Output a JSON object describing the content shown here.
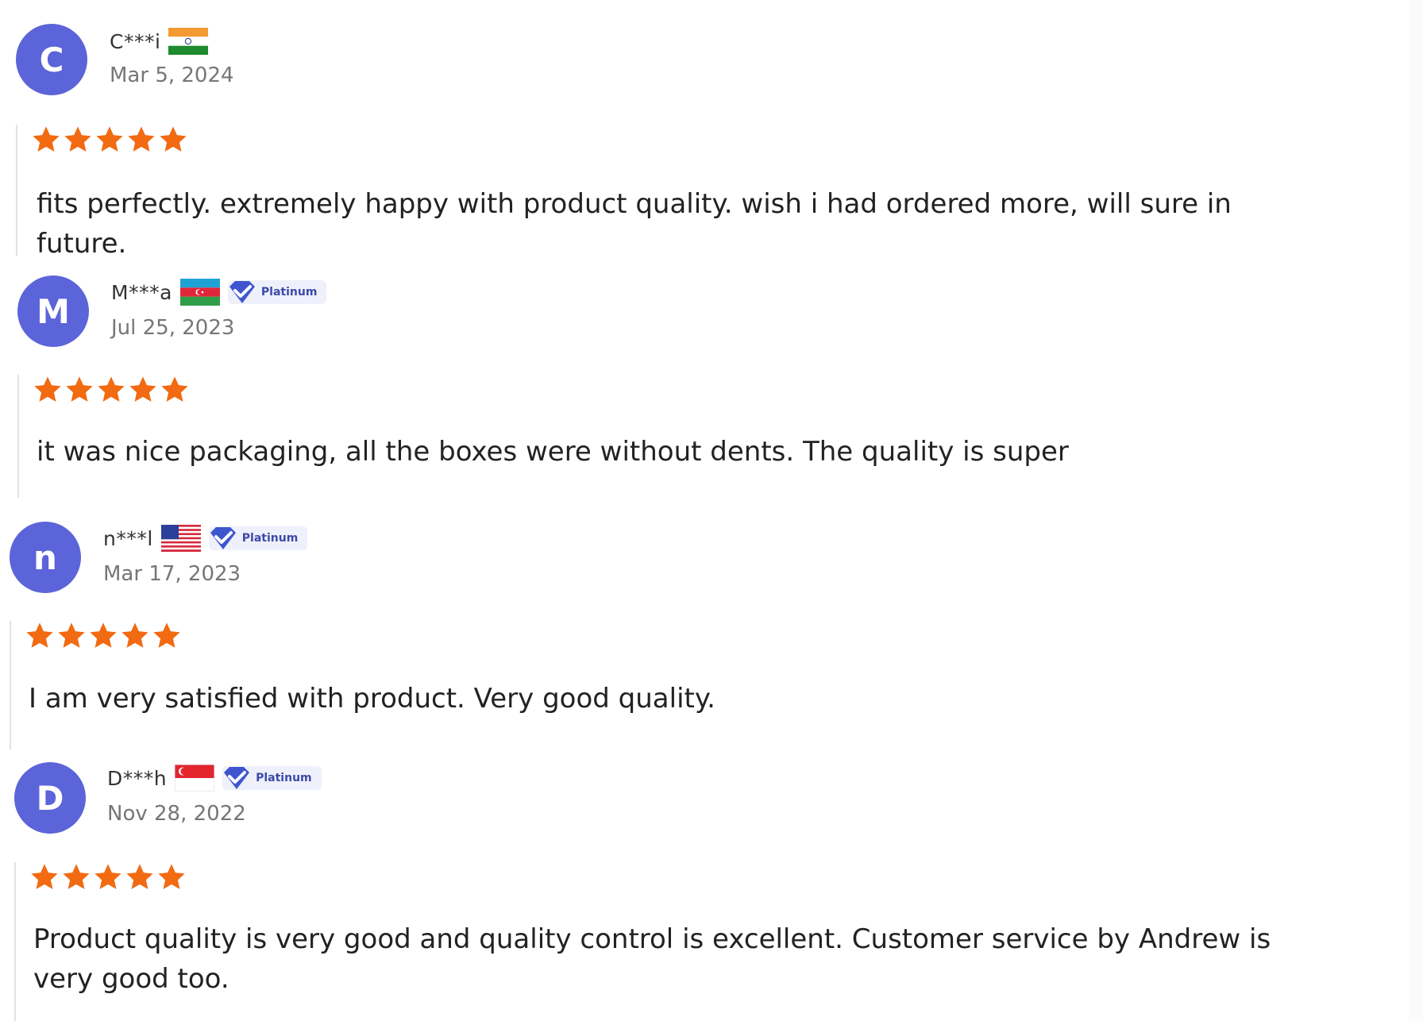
{
  "reviews": [
    {
      "initial": "C",
      "name": "C***i",
      "flag": "india-flag",
      "badge": null,
      "date": "Mar 5, 2024",
      "rating": 5,
      "text": "fits perfectly. extremely happy with product quality. wish i had ordered more, will sure in future."
    },
    {
      "initial": "M",
      "name": "M***a",
      "flag": "azerbaijan-flag",
      "badge": "Platinum",
      "date": "Jul 25, 2023",
      "rating": 5,
      "text": "it was nice packaging, all the boxes were without dents. The quality is super"
    },
    {
      "initial": "n",
      "name": "n***l",
      "flag": "usa-flag",
      "badge": "Platinum",
      "date": "Mar 17, 2023",
      "rating": 5,
      "text": "I am very satisfied with product. Very good quality."
    },
    {
      "initial": "D",
      "name": "D***h",
      "flag": "singapore-flag",
      "badge": "Platinum",
      "date": "Nov 28, 2022",
      "rating": 5,
      "text": "Product quality is very good and quality control is excellent. Customer service by Andrew is very good too."
    }
  ],
  "colors": {
    "avatar": "#5b64d8",
    "star": "#f26a12",
    "badge_bg": "#eef0fb",
    "badge_text": "#3d4aa8",
    "date": "#767676"
  },
  "icons": {
    "star": "star-icon",
    "badge": "diamond-check-icon"
  }
}
